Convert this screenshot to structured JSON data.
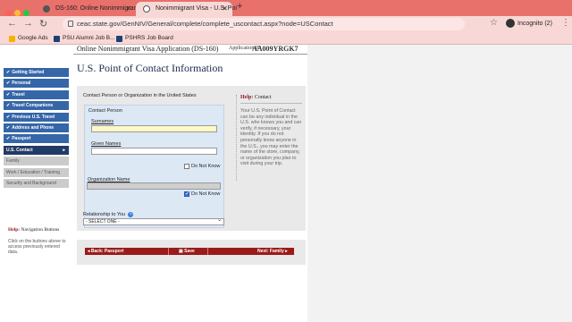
{
  "browser": {
    "tabs": [
      {
        "title": "DS-160: Online Nonimmigrant"
      },
      {
        "title": "Nonimmigrant Visa - U.S. Poi"
      }
    ],
    "url": "ceac.state.gov/GenNIV/General/complete/complete_uscontact.aspx?node=USContact",
    "incognito_label": "Incognito (2)",
    "bookmarks": [
      "Google Ads",
      "PSU Alumni Job B...",
      "PSHRS Job Board"
    ],
    "colors": {
      "frame": "#e8716b",
      "toolbar": "#f8d8d6"
    }
  },
  "header": {
    "app_title": "Online Nonimmigrant Visa Application (DS-160)",
    "app_id_label": "Application ID",
    "app_id": "AA009YRGK7"
  },
  "page_title": "U.S. Point of Contact Information",
  "sidebar": {
    "items": [
      {
        "label": "Getting Started",
        "state": "done"
      },
      {
        "label": "Personal",
        "state": "done"
      },
      {
        "label": "Travel",
        "state": "done"
      },
      {
        "label": "Travel Companions",
        "state": "done"
      },
      {
        "label": "Previous U.S. Travel",
        "state": "done"
      },
      {
        "label": "Address and Phone",
        "state": "done"
      },
      {
        "label": "Passport",
        "state": "done"
      },
      {
        "label": "U.S. Contact",
        "state": "current"
      },
      {
        "label": "Family",
        "state": "todo"
      },
      {
        "label": "Work / Education / Training",
        "state": "todo"
      },
      {
        "label": "Security and Background",
        "state": "todo"
      }
    ],
    "help_title_prefix": "Help:",
    "help_title": "Navigation Buttons",
    "help_text": "Click on the buttons above to access previously entered data."
  },
  "form": {
    "section_label": "Contact Person or Organization in the United States",
    "contact_person_title": "Contact Person",
    "surnames_label": "Surnames",
    "surnames_value": "",
    "given_names_label": "Given Names",
    "given_names_value": "",
    "do_not_know_1": "Do Not Know",
    "do_not_know_1_checked": false,
    "organization_label": "Organization Name",
    "organization_value": "",
    "do_not_know_2": "Do Not Know",
    "do_not_know_2_checked": true,
    "relationship_label": "Relationship to You",
    "relationship_value": "- SELECT ONE -"
  },
  "help": {
    "title_prefix": "Help:",
    "title": "Contact",
    "body": "Your U.S. Point of Contact can be any individual in the U.S. who knows you and can verify, if necessary, your identity. If you do not personally know anyone in the U.S., you may enter the name of the store, company, or organization you plan to visit during your trip."
  },
  "buttons": {
    "back": "◂ Back: Passport",
    "save": "Save",
    "next": "Next: Family ▸"
  }
}
